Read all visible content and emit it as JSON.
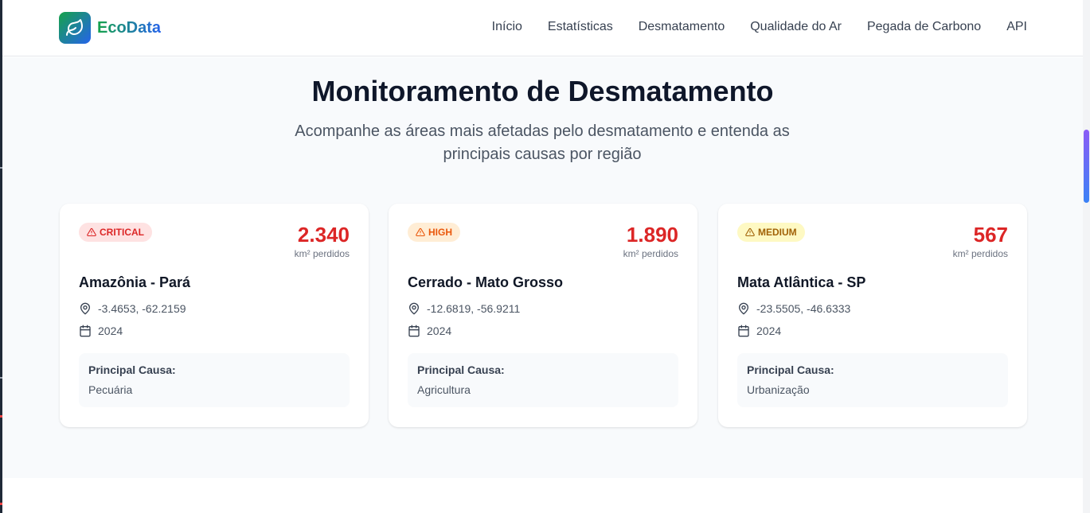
{
  "brand": {
    "name": "EcoData"
  },
  "nav": {
    "items": [
      "Início",
      "Estatísticas",
      "Desmatamento",
      "Qualidade do Ar",
      "Pegada de Carbono",
      "API"
    ]
  },
  "hero": {
    "title": "Monitoramento de Desmatamento",
    "subtitle": "Acompanhe as áreas mais afetadas pelo desmatamento e entenda as principais causas por região"
  },
  "colors": {
    "critical_bg": "#fee2e2",
    "critical_fg": "#dc2626",
    "high_bg": "#ffedd5",
    "high_fg": "#ea580c",
    "medium_bg": "#fef9c3",
    "medium_fg": "#a16207",
    "metric": "#dc2626"
  },
  "cards": [
    {
      "severity": "CRITICAL",
      "area": "2.340",
      "unit": "km² perdidos",
      "region": "Amazônia - Pará",
      "coords": "-3.4653, -62.2159",
      "year": "2024",
      "cause_label": "Principal Causa:",
      "cause": "Pecuária"
    },
    {
      "severity": "HIGH",
      "area": "1.890",
      "unit": "km² perdidos",
      "region": "Cerrado - Mato Grosso",
      "coords": "-12.6819, -56.9211",
      "year": "2024",
      "cause_label": "Principal Causa:",
      "cause": "Agricultura"
    },
    {
      "severity": "MEDIUM",
      "area": "567",
      "unit": "km² perdidos",
      "region": "Mata Atlântica - SP",
      "coords": "-23.5505, -46.6333",
      "year": "2024",
      "cause_label": "Principal Causa:",
      "cause": "Urbanização"
    }
  ]
}
